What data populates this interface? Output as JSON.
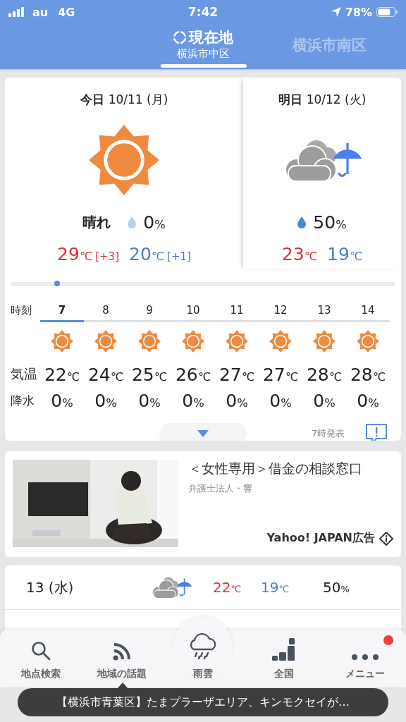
{
  "status_bar": {
    "carrier": "au",
    "network": "4G",
    "time": "7:42",
    "battery": "78%"
  },
  "location_tabs": [
    {
      "label": "現在地",
      "sublabel": "横浜市中区",
      "selected": true
    },
    {
      "label": "横浜市南区",
      "selected": false
    }
  ],
  "days": [
    {
      "label": "今日",
      "date": "10/11 (月)",
      "kind": "sunny",
      "weather": "晴れ",
      "precip": {
        "value": "0",
        "unit": "%"
      },
      "high": {
        "value": "29",
        "unit": "℃",
        "diff": "[+3]"
      },
      "low": {
        "value": "20",
        "unit": "℃",
        "diff": "[+1]"
      }
    },
    {
      "label": "明日",
      "date": "10/12 (火)",
      "kind": "cloudy_rain",
      "precip": {
        "value": "50",
        "unit": "%"
      },
      "high": {
        "value": "23",
        "unit": "℃"
      },
      "low": {
        "value": "19",
        "unit": "℃"
      }
    }
  ],
  "hourly": {
    "row_labels": [
      "時刻",
      "気温",
      "降水"
    ],
    "hours": [
      {
        "hour": "7",
        "kind": "sunny",
        "temp": {
          "value": "22",
          "unit": "℃"
        },
        "precip": {
          "value": "0",
          "unit": "%"
        },
        "selected": true
      },
      {
        "hour": "8",
        "kind": "sunny",
        "temp": {
          "value": "24",
          "unit": "℃"
        },
        "precip": {
          "value": "0",
          "unit": "%"
        },
        "selected": false
      },
      {
        "hour": "9",
        "kind": "sunny",
        "temp": {
          "value": "25",
          "unit": "℃"
        },
        "precip": {
          "value": "0",
          "unit": "%"
        },
        "selected": false
      },
      {
        "hour": "10",
        "kind": "sunny",
        "temp": {
          "value": "26",
          "unit": "℃"
        },
        "precip": {
          "value": "0",
          "unit": "%"
        },
        "selected": false
      },
      {
        "hour": "11",
        "kind": "sunny",
        "temp": {
          "value": "27",
          "unit": "℃"
        },
        "precip": {
          "value": "0",
          "unit": "%"
        },
        "selected": false
      },
      {
        "hour": "12",
        "kind": "sunny",
        "temp": {
          "value": "27",
          "unit": "℃"
        },
        "precip": {
          "value": "0",
          "unit": "%"
        },
        "selected": false
      },
      {
        "hour": "13",
        "kind": "sunny",
        "temp": {
          "value": "28",
          "unit": "℃"
        },
        "precip": {
          "value": "0",
          "unit": "%"
        },
        "selected": false
      },
      {
        "hour": "14",
        "kind": "sunny",
        "temp": {
          "value": "28",
          "unit": "℃"
        },
        "precip": {
          "value": "0",
          "unit": "%"
        },
        "selected": false
      }
    ]
  },
  "issued": "7時発表",
  "ad": {
    "title": "＜女性専用＞借金の相談窓口",
    "advertiser": "弁護士法人・響",
    "sponsor": "Yahoo! JAPAN広告"
  },
  "forecast": [
    {
      "date": "13 (水)",
      "kind": "cloudy_rain",
      "high": {
        "value": "22",
        "unit": "℃"
      },
      "low": {
        "value": "19",
        "unit": "℃"
      },
      "precip": {
        "value": "50",
        "unit": "%"
      }
    }
  ],
  "nav": [
    {
      "label": "地点検索",
      "kind": "search",
      "badge": false
    },
    {
      "label": "地域の話題",
      "kind": "feed",
      "badge": false
    },
    {
      "label": "雨雲",
      "kind": "rain",
      "badge": false
    },
    {
      "label": "全国",
      "kind": "blocks",
      "badge": false
    },
    {
      "label": "メニュー",
      "kind": "menu",
      "badge": true
    }
  ],
  "ticker": "【横浜市青葉区】たまプラーザエリア、キンモクセイが…"
}
